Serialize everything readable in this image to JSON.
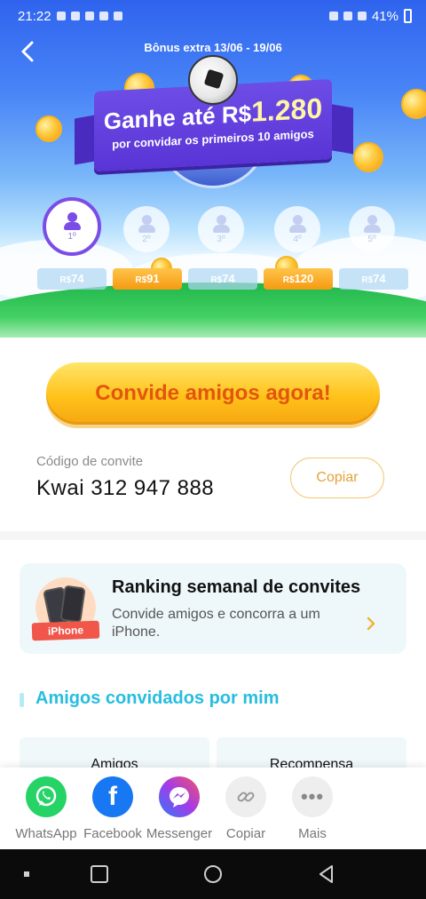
{
  "status_bar": {
    "time": "21:22",
    "battery": "41%"
  },
  "banner": {
    "period": "Bônus extra 13/06 - 19/06",
    "headline_prefix": "Ganhe até",
    "headline_currency": "R$",
    "headline_amount": "1.280",
    "subheadline": "por convidar os primeiros 10 amigos"
  },
  "slots": [
    {
      "rank": "1º",
      "currency": "R$",
      "amount": "74",
      "active": true,
      "highlight": false
    },
    {
      "rank": "2º",
      "currency": "R$",
      "amount": "91",
      "active": false,
      "highlight": true
    },
    {
      "rank": "3º",
      "currency": "R$",
      "amount": "74",
      "active": false,
      "highlight": false
    },
    {
      "rank": "4º",
      "currency": "R$",
      "amount": "120",
      "active": false,
      "highlight": true
    },
    {
      "rank": "5º",
      "currency": "R$",
      "amount": "74",
      "active": false,
      "highlight": false
    }
  ],
  "invite": {
    "button_label": "Convide amigos agora!",
    "code_label": "Código de convite",
    "code_value": "Kwai 312 947 888",
    "copy_label": "Copiar"
  },
  "ranking": {
    "title": "Ranking semanal de convites",
    "description": "Convide amigos e concorra a um iPhone.",
    "badge": "iPhone"
  },
  "friends": {
    "title": "Amigos convidados por mim",
    "columns": [
      "Amigos",
      "Recompensa"
    ]
  },
  "share": {
    "items": [
      {
        "label": "WhatsApp",
        "icon": "whatsapp-icon",
        "color": "#25d366"
      },
      {
        "label": "Facebook",
        "icon": "facebook-icon",
        "color": "#1877f2"
      },
      {
        "label": "Messenger",
        "icon": "messenger-icon",
        "color": "#8b3cf0"
      },
      {
        "label": "Copiar",
        "icon": "link-icon",
        "color": "#eeeeee"
      },
      {
        "label": "Mais",
        "icon": "more-icon",
        "color": "#eeeeee"
      }
    ]
  },
  "colors": {
    "accent_purple": "#7b4de6",
    "accent_orange": "#e2560e",
    "accent_cyan": "#26bde0",
    "gold": "#ffc21a"
  }
}
